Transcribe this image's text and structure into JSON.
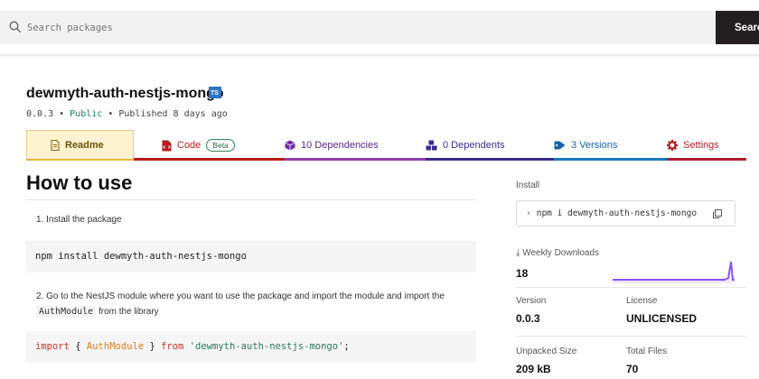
{
  "search": {
    "placeholder": "Search packages",
    "button_label": "Search"
  },
  "package": {
    "name": "dewmyth-auth-nestjs-mongo",
    "ts_badge": "TS",
    "version": "0.0.3",
    "sep1": " • ",
    "visibility": "Public",
    "sep2": " • ",
    "published": "Published 8 days ago"
  },
  "tabs": {
    "readme": "Readme",
    "code": "Code",
    "beta": "Beta",
    "dependencies": "10 Dependencies",
    "dependents": "0 Dependents",
    "versions": "3 Versions",
    "settings": "Settings"
  },
  "readme": {
    "heading": "How to use",
    "step1": "1. Install the package",
    "code1": "npm install dewmyth-auth-nestjs-mongo",
    "step2_prefix": "2. Go to the NestJS module where you want to use the package and import the module and import the ",
    "step2_code": "AuthModule",
    "step2_suffix": " from the library",
    "code2": {
      "kw1": "import",
      "brace_open": " { ",
      "ident": "AuthModule",
      "brace_close": " } ",
      "kw2": "from",
      "space": " ",
      "str": "'dewmyth-auth-nestjs-mongo'",
      "semi": ";"
    }
  },
  "sidebar": {
    "install_label": "Install",
    "install_cmd": "npm i dewmyth-auth-nestjs-mongo",
    "weekly_label": "Weekly Downloads",
    "weekly_value": "18",
    "version_label": "Version",
    "version_value": "0.0.3",
    "license_label": "License",
    "license_value": "UNLICENSED",
    "unpacked_label": "Unpacked Size",
    "unpacked_value": "209 kB",
    "files_label": "Total Files",
    "files_value": "70"
  },
  "colors": {
    "code_tab": "#b71c1c",
    "deps_tab": "#5b2a86",
    "dependents_tab": "#3a2d8f",
    "versions_tab": "#1565a6",
    "settings_tab": "#b41e2e",
    "sparkline": "#8956ff"
  }
}
